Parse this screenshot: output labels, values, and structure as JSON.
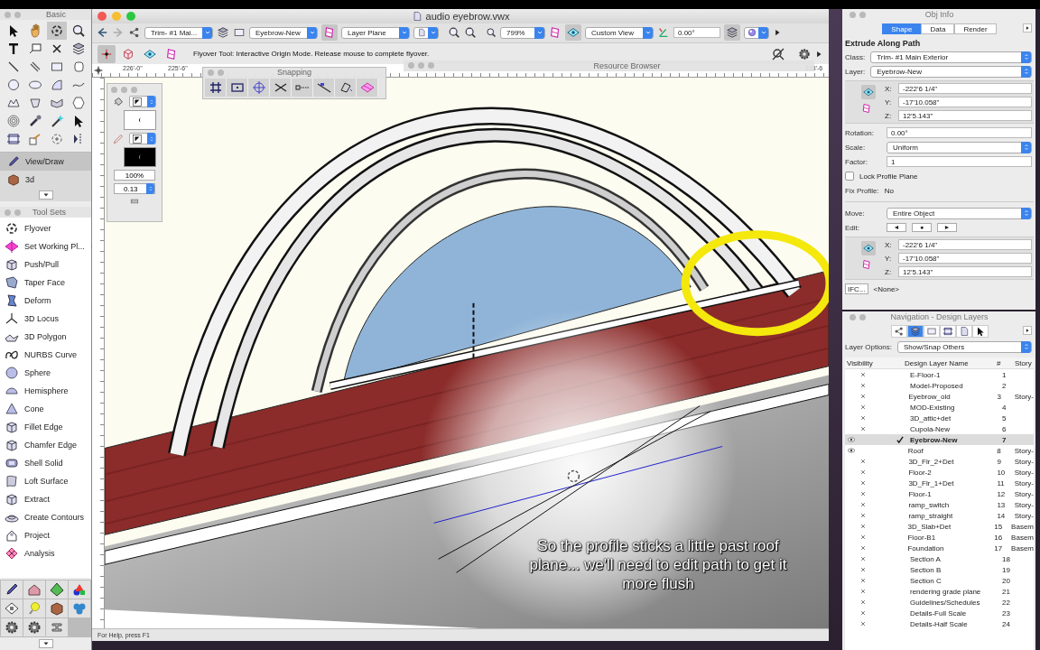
{
  "basic_palette": {
    "title": "Basic",
    "tools": [
      {
        "selected": false
      },
      {
        "selected": false
      },
      {
        "selected": true
      },
      {
        "selected": false
      },
      {
        "selected": false
      },
      {
        "selected": false
      },
      {
        "selected": false
      },
      {
        "selected": false
      },
      {
        "selected": false
      },
      {
        "selected": false
      },
      {
        "selected": false
      },
      {
        "selected": false
      },
      {
        "selected": false
      },
      {
        "selected": false
      },
      {
        "selected": false
      },
      {
        "selected": false
      },
      {
        "selected": false
      },
      {
        "selected": false
      },
      {
        "selected": false
      },
      {
        "selected": false
      },
      {
        "selected": false
      },
      {
        "selected": false
      },
      {
        "selected": false
      },
      {
        "selected": false
      },
      {
        "selected": false
      },
      {
        "selected": false
      },
      {
        "selected": false
      },
      {
        "selected": false
      }
    ],
    "workspaces": [
      {
        "label": "View/Draw",
        "selected": true
      },
      {
        "label": "3d",
        "selected": false
      }
    ]
  },
  "tool_sets": {
    "title": "Tool Sets",
    "items": [
      {
        "label": "Flyover",
        "submenu": false
      },
      {
        "label": "Set Working Pl...",
        "submenu": true
      },
      {
        "label": "Push/Pull",
        "submenu": false
      },
      {
        "label": "Taper Face",
        "submenu": false
      },
      {
        "label": "Deform",
        "submenu": false
      },
      {
        "label": "3D Locus",
        "submenu": false
      },
      {
        "label": "3D Polygon",
        "submenu": false
      },
      {
        "label": "NURBS Curve",
        "submenu": false
      },
      {
        "label": "Sphere",
        "submenu": false
      },
      {
        "label": "Hemisphere",
        "submenu": false
      },
      {
        "label": "Cone",
        "submenu": false
      },
      {
        "label": "Fillet Edge",
        "submenu": false
      },
      {
        "label": "Chamfer Edge",
        "submenu": false
      },
      {
        "label": "Shell Solid",
        "submenu": false
      },
      {
        "label": "Loft Surface",
        "submenu": false
      },
      {
        "label": "Extract",
        "submenu": false
      },
      {
        "label": "Create Contours",
        "submenu": false
      },
      {
        "label": "Project",
        "submenu": false
      },
      {
        "label": "Analysis",
        "submenu": false
      }
    ]
  },
  "window": {
    "title": "audio eyebrow.vwx"
  },
  "view_bar": {
    "class": "Trim- #1 Mai...",
    "layer": "Eyebrow-New",
    "plane": "Layer Plane",
    "zoom": "799%",
    "view": "Custom View",
    "angle": "0.00°"
  },
  "mode_bar": {
    "modes": [
      {
        "selected": true
      },
      {
        "selected": false
      },
      {
        "selected": false
      },
      {
        "selected": false
      }
    ],
    "message": "Flyover Tool: Interactive Origin Mode. Release mouse to complete flyover."
  },
  "ruler": {
    "labels": [
      "226'-0\"",
      "225'-6\"",
      "218'-6"
    ]
  },
  "snapping": {
    "title": "Snapping"
  },
  "resource_browser": {
    "title": "Resource Browser"
  },
  "attributes": {
    "opacity": "100%",
    "line_weight": "0.13"
  },
  "caption": "So the profile sticks a little past roof plane... we'll need to edit path to get it more flush",
  "status_bar": "For Help, press F1",
  "obj_info": {
    "title": "Obj Info",
    "tabs": [
      {
        "label": "Shape",
        "selected": true
      },
      {
        "label": "Data",
        "selected": false
      },
      {
        "label": "Render",
        "selected": false
      }
    ],
    "object_type": "Extrude Along Path",
    "class": {
      "label": "Class:",
      "value": "Trim- #1 Main Exterior"
    },
    "layer": {
      "label": "Layer:",
      "value": "Eyebrow-New"
    },
    "position": [
      {
        "axis": "X:",
        "value": "-222'6 1/4\""
      },
      {
        "axis": "Y:",
        "value": "-17'10.058\""
      },
      {
        "axis": "Z:",
        "value": "12'5.143\""
      }
    ],
    "rotation": {
      "label": "Rotation:",
      "value": "0.00°"
    },
    "scale": {
      "label": "Scale:",
      "value": "Uniform"
    },
    "factor": {
      "label": "Factor:",
      "value": "1"
    },
    "lock_profile_plane": {
      "label": "Lock Profile Plane",
      "checked": false
    },
    "fix_profile": {
      "label": "Fix Profile:",
      "value": "No"
    },
    "move": {
      "label": "Move:",
      "value": "Entire Object"
    },
    "edit": {
      "label": "Edit:",
      "buttons": [
        "◄",
        "●",
        "►"
      ]
    },
    "path_position": [
      {
        "axis": "X:",
        "value": "-222'6 1/4\""
      },
      {
        "axis": "Y:",
        "value": "-17'10.058\""
      },
      {
        "axis": "Z:",
        "value": "12'5.143\""
      }
    ],
    "ifc": {
      "button": "IFC...",
      "value": "<None>"
    }
  },
  "navigation": {
    "title": "Navigation - Design Layers",
    "tabs": [
      {
        "selected": false
      },
      {
        "selected": true
      },
      {
        "selected": false
      },
      {
        "selected": false
      },
      {
        "selected": false
      },
      {
        "selected": false
      }
    ],
    "layer_options": {
      "label": "Layer Options:",
      "value": "Show/Snap Others"
    },
    "columns": [
      "Visibility",
      "Design Layer Name",
      "#",
      "Story"
    ],
    "rows": [
      {
        "visible": false,
        "active": false,
        "name": "E-Floor-1",
        "number": "1",
        "story": ""
      },
      {
        "visible": false,
        "active": false,
        "name": "Model-Proposed",
        "number": "2",
        "story": ""
      },
      {
        "visible": false,
        "active": false,
        "name": "Eyebrow_old",
        "number": "3",
        "story": "Story-"
      },
      {
        "visible": false,
        "active": false,
        "name": "MOD-Existing",
        "number": "4",
        "story": ""
      },
      {
        "visible": false,
        "active": false,
        "name": "3D_attic+det",
        "number": "5",
        "story": ""
      },
      {
        "visible": false,
        "active": false,
        "name": "Cupola-New",
        "number": "6",
        "story": ""
      },
      {
        "visible": true,
        "active": true,
        "name": "Eyebrow-New",
        "number": "7",
        "story": ""
      },
      {
        "visible": true,
        "active": false,
        "name": "Roof",
        "number": "8",
        "story": "Story-"
      },
      {
        "visible": false,
        "active": false,
        "name": "3D_Flr_2+Det",
        "number": "9",
        "story": "Story-"
      },
      {
        "visible": false,
        "active": false,
        "name": "Floor-2",
        "number": "10",
        "story": "Story-"
      },
      {
        "visible": false,
        "active": false,
        "name": "3D_Flr_1+Det",
        "number": "11",
        "story": "Story-"
      },
      {
        "visible": false,
        "active": false,
        "name": "Floor-1",
        "number": "12",
        "story": "Story-"
      },
      {
        "visible": false,
        "active": false,
        "name": "ramp_switch",
        "number": "13",
        "story": "Story-"
      },
      {
        "visible": false,
        "active": false,
        "name": "ramp_straight",
        "number": "14",
        "story": "Story-"
      },
      {
        "visible": false,
        "active": false,
        "name": "3D_Slab+Det",
        "number": "15",
        "story": "Basem"
      },
      {
        "visible": false,
        "active": false,
        "name": "Floor-B1",
        "number": "16",
        "story": "Basem"
      },
      {
        "visible": false,
        "active": false,
        "name": "Foundation",
        "number": "17",
        "story": "Basem"
      },
      {
        "visible": false,
        "active": false,
        "name": "Section A",
        "number": "18",
        "story": ""
      },
      {
        "visible": false,
        "active": false,
        "name": "Section B",
        "number": "19",
        "story": ""
      },
      {
        "visible": false,
        "active": false,
        "name": "Section C",
        "number": "20",
        "story": ""
      },
      {
        "visible": false,
        "active": false,
        "name": "rendering grade plane",
        "number": "21",
        "story": ""
      },
      {
        "visible": false,
        "active": false,
        "name": "Guidelines/Schedules",
        "number": "22",
        "story": ""
      },
      {
        "visible": false,
        "active": false,
        "name": "Details-Full Scale",
        "number": "23",
        "story": ""
      },
      {
        "visible": false,
        "active": false,
        "name": "Details-Half Scale",
        "number": "24",
        "story": ""
      }
    ]
  }
}
